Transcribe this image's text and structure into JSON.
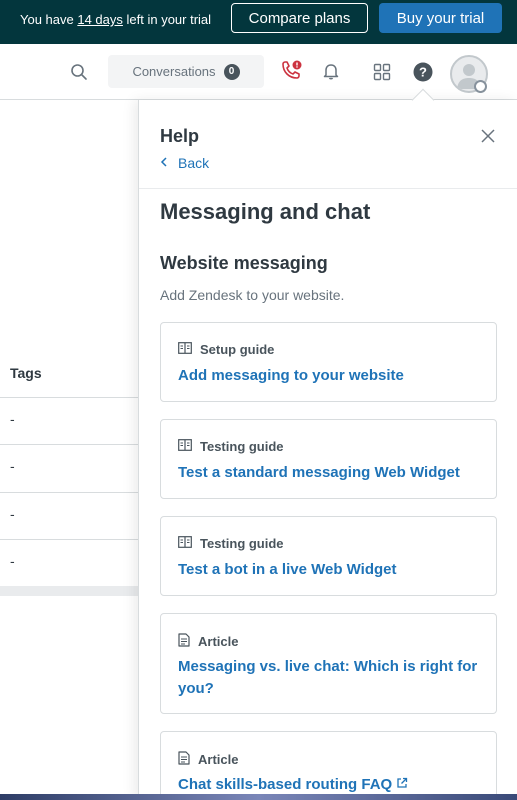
{
  "trial_banner": {
    "prefix": "You have ",
    "days": "14 days",
    "suffix": " left in your trial",
    "compare_label": "Compare plans",
    "buy_label": "Buy your trial"
  },
  "nav": {
    "conversations_label": "Conversations",
    "conversations_count": "0"
  },
  "table": {
    "column_header": "Tags",
    "rows": [
      "-",
      "-",
      "-",
      "-"
    ]
  },
  "help": {
    "title": "Help",
    "back_label": "Back",
    "section_title": "Messaging and chat",
    "subsection_title": "Website messaging",
    "subsection_desc": "Add Zendesk to your website.",
    "cards": [
      {
        "type": "Setup guide",
        "title": "Add messaging to your website",
        "icon": "book-icon"
      },
      {
        "type": "Testing guide",
        "title": "Test a standard messaging Web Widget",
        "icon": "book-icon"
      },
      {
        "type": "Testing guide",
        "title": "Test a bot in a live Web Widget",
        "icon": "book-icon"
      },
      {
        "type": "Article",
        "title": "Messaging vs. live chat: Which is right for you?",
        "icon": "document-icon"
      },
      {
        "type": "Article",
        "title": "Chat skills-based routing FAQ",
        "icon": "document-icon",
        "external": true
      }
    ]
  },
  "colors": {
    "banner_bg": "#03363d",
    "accent_blue": "#1f73b7",
    "alert_red": "#cc3340"
  }
}
